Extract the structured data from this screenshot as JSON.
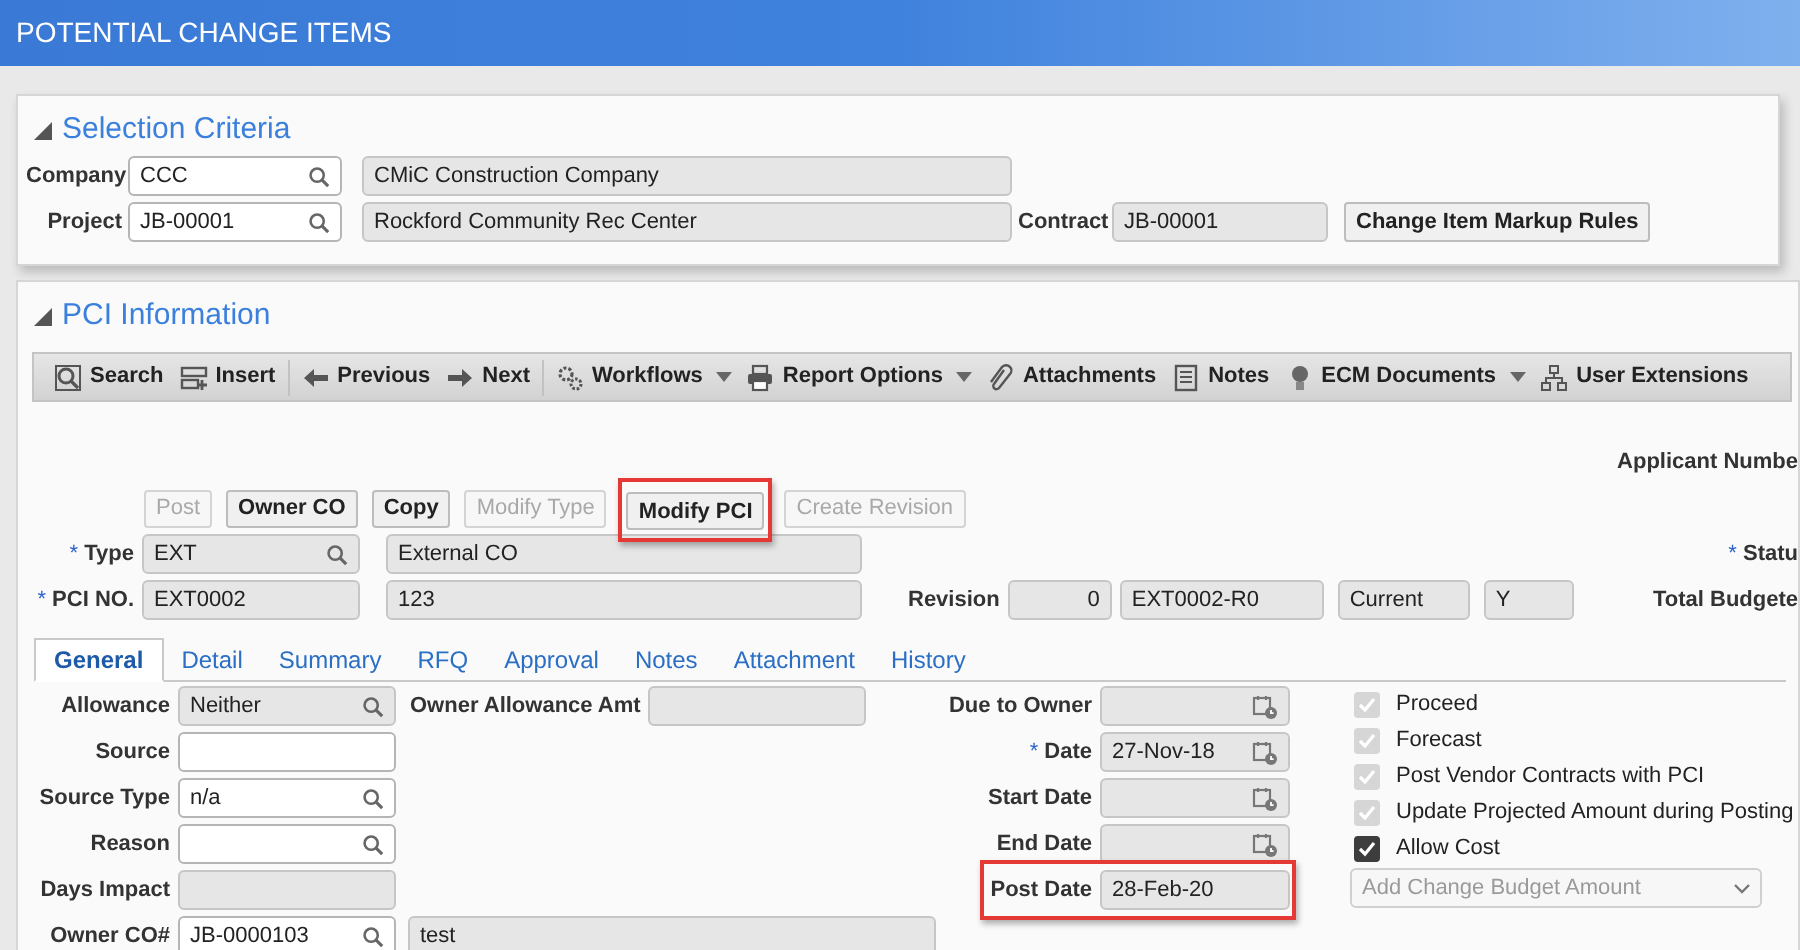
{
  "window": {
    "title": "POTENTIAL CHANGE ITEMS"
  },
  "selection_criteria": {
    "title": "Selection Criteria",
    "company": {
      "label": "Company",
      "code": {
        "kind": "lookup",
        "value": "CCC",
        "readonly": false
      },
      "name": {
        "value": "CMiC Construction Company",
        "readonly": true
      }
    },
    "project": {
      "label": "Project",
      "code": {
        "kind": "lookup",
        "value": "JB-00001",
        "readonly": false
      },
      "name": {
        "value": "Rockford Community Rec Center",
        "readonly": true
      }
    },
    "contract": {
      "label": "Contract",
      "field": {
        "value": "JB-00001",
        "readonly": true
      }
    },
    "markup_button": "Change Item Markup Rules"
  },
  "pci_information": {
    "title": "PCI Information",
    "toolbar": [
      {
        "label": "Search",
        "dropdown": false
      },
      {
        "label": "Insert",
        "dropdown": false
      },
      {
        "label": "Previous",
        "dropdown": false
      },
      {
        "label": "Next",
        "dropdown": false
      },
      {
        "label": "Workflows",
        "dropdown": true
      },
      {
        "label": "Report Options",
        "dropdown": true
      },
      {
        "label": "Attachments",
        "dropdown": false
      },
      {
        "label": "Notes",
        "dropdown": false
      },
      {
        "label": "ECM Documents",
        "dropdown": true
      },
      {
        "label": "User Extensions",
        "dropdown": false
      }
    ],
    "applicant_number_label": "Applicant Numbe",
    "actions": [
      {
        "label": "Post",
        "disabled": true,
        "highlighted": false
      },
      {
        "label": "Owner CO",
        "disabled": false,
        "highlighted": false
      },
      {
        "label": "Copy",
        "disabled": false,
        "highlighted": false
      },
      {
        "label": "Modify Type",
        "disabled": true,
        "highlighted": false
      },
      {
        "label": "Modify PCI",
        "disabled": false,
        "highlighted": true
      },
      {
        "label": "Create Revision",
        "disabled": true,
        "highlighted": false
      }
    ],
    "type": {
      "required_mark": "*",
      "label": "Type",
      "code": {
        "kind": "lookup",
        "value": "EXT",
        "readonly": true
      },
      "name": {
        "value": "External CO",
        "readonly": true
      }
    },
    "status": {
      "required_mark": "*",
      "label": "Statu"
    },
    "pci_no": {
      "required_mark": "*",
      "label": "PCI NO.",
      "code": {
        "value": "EXT0002",
        "readonly": true
      },
      "description": {
        "value": "123",
        "readonly": true
      }
    },
    "revision": {
      "label": "Revision",
      "number": {
        "kind": "number",
        "value": "0",
        "readonly": true
      },
      "code": {
        "value": "EXT0002-R0",
        "readonly": true
      },
      "state": {
        "value": "Current",
        "readonly": true
      },
      "flag": {
        "value": "Y",
        "readonly": true
      }
    },
    "total_budgeted_label": "Total Budgete",
    "tabs": [
      {
        "label": "General",
        "selected": true
      },
      {
        "label": "Detail",
        "selected": false
      },
      {
        "label": "Summary",
        "selected": false
      },
      {
        "label": "RFQ",
        "selected": false
      },
      {
        "label": "Approval",
        "selected": false
      },
      {
        "label": "Notes",
        "selected": false
      },
      {
        "label": "Attachment",
        "selected": false
      },
      {
        "label": "History",
        "selected": false
      }
    ],
    "general": {
      "left": [
        {
          "label": "Allowance",
          "field": {
            "kind": "lookup",
            "value": "Neither",
            "readonly": true
          },
          "extra_label": "Owner Allowance Amt",
          "extra_field": {
            "readonly": true
          }
        },
        {
          "label": "Source",
          "field": {
            "readonly": false
          }
        },
        {
          "label": "Source Type",
          "field": {
            "kind": "lookup",
            "value": "n/a",
            "readonly": false
          }
        },
        {
          "label": "Reason",
          "field": {
            "kind": "lookup",
            "readonly": false
          }
        },
        {
          "label": "Days Impact",
          "field": {
            "readonly": true
          }
        },
        {
          "label": "Owner CO#",
          "field": {
            "kind": "lookup",
            "value": "JB-0000103",
            "readonly": false
          },
          "extra_field": {
            "value": "test",
            "readonly": true
          }
        }
      ],
      "middle": [
        {
          "label": "Due to Owner",
          "highlighted": false,
          "field": {
            "kind": "date",
            "readonly": true
          }
        },
        {
          "required_mark": "*",
          "label": "Date",
          "highlighted": false,
          "field": {
            "kind": "date",
            "value": "27-Nov-18",
            "readonly": true
          }
        },
        {
          "label": "Start Date",
          "highlighted": false,
          "field": {
            "kind": "date",
            "readonly": true
          }
        },
        {
          "label": "End Date",
          "highlighted": false,
          "field": {
            "kind": "date",
            "readonly": true
          }
        },
        {
          "label": "Post Date",
          "highlighted": true,
          "field": {
            "value": "28-Feb-20",
            "readonly": true
          }
        }
      ],
      "options": [
        {
          "label": "Proceed",
          "checked": true,
          "disabled": true
        },
        {
          "label": "Forecast",
          "checked": true,
          "disabled": true
        },
        {
          "label": "Post Vendor Contracts with PCI",
          "checked": true,
          "disabled": true
        },
        {
          "label": "Update Projected Amount during Posting",
          "checked": true,
          "disabled": true
        },
        {
          "label": "Allow Cost",
          "checked": true,
          "disabled": false
        }
      ],
      "budget_select": {
        "placeholder": "Add Change Budget Amount",
        "disabled": true
      }
    }
  }
}
